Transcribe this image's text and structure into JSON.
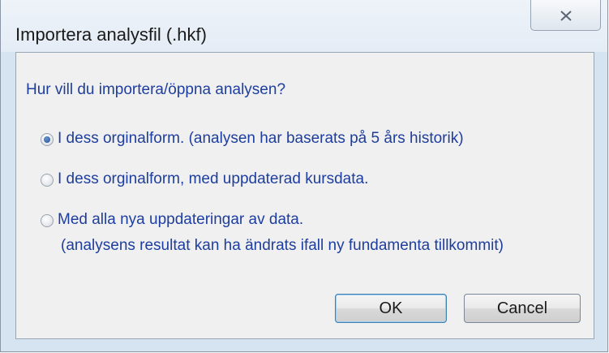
{
  "dialog": {
    "title": "Importera analysfil (.hkf)",
    "question": "Hur vill du importera/öppna analysen?",
    "options": [
      {
        "label": "I dess orginalform.   (analysen har baserats på 5 års historik)",
        "selected": true
      },
      {
        "label": "I dess orginalform, med uppdaterad kursdata.",
        "selected": false
      },
      {
        "label": "Med alla nya uppdateringar av data.",
        "selected": false
      }
    ],
    "note": "(analysens resultat kan ha ändrats ifall ny fundamenta tillkommit)",
    "ok_label": "OK",
    "cancel_label": "Cancel"
  },
  "icons": {
    "close": "close-icon"
  },
  "colors": {
    "text_blue": "#1e3e9e",
    "frame": "#d6e3f1"
  }
}
